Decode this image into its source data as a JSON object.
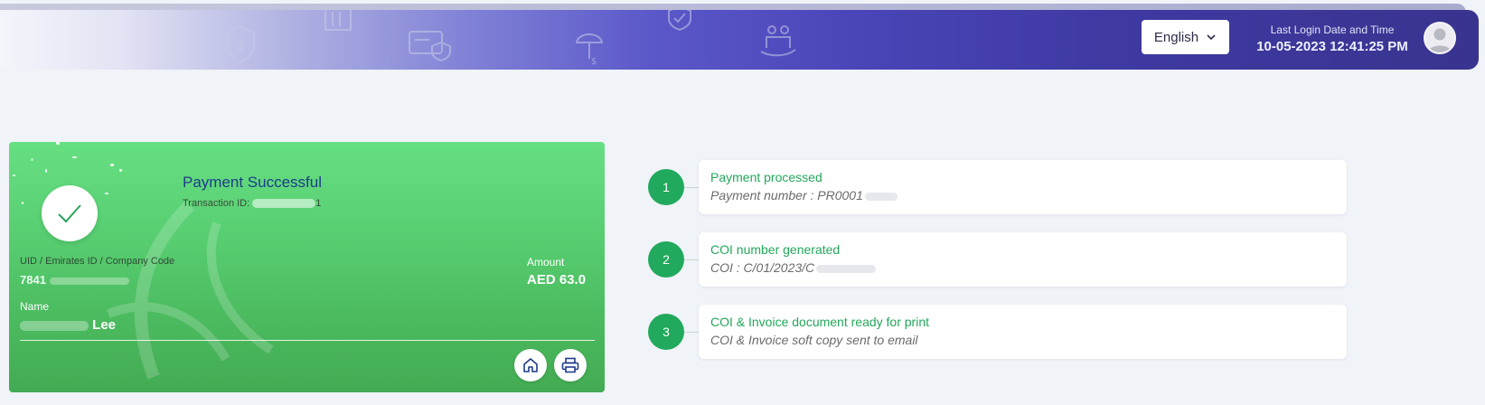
{
  "header": {
    "language": "English",
    "last_login_label": "Last Login Date and Time",
    "last_login_value": "10-05-2023 12:41:25 PM"
  },
  "payment": {
    "title": "Payment Successful",
    "transaction_id_label": "Transaction ID:",
    "transaction_id_visible_end": "1",
    "uid_label": "UID / Emirates ID / Company Code",
    "uid_value_visible": "7841",
    "amount_label": "Amount",
    "amount_value": "AED 63.0",
    "name_label": "Name",
    "name_value_visible": "Lee"
  },
  "steps": [
    {
      "number": "1",
      "title": "Payment processed",
      "subtitle": "Payment number : PR0001"
    },
    {
      "number": "2",
      "title": "COI number generated",
      "subtitle": "COI : C/01/2023/C"
    },
    {
      "number": "3",
      "title": "COI & Invoice document ready for print",
      "subtitle": "COI & Invoice soft copy sent to email"
    }
  ],
  "icons": {
    "language_dropdown": "chevron-down-icon",
    "avatar": "user-avatar-icon",
    "success": "checkmark-icon",
    "home": "home-icon",
    "print": "printer-icon"
  },
  "colors": {
    "header_start": "#f4f5fb",
    "header_end": "#39348f",
    "card_green": "#57cd70",
    "step_green": "#21a95d",
    "title_blue": "#1e3c8c"
  }
}
